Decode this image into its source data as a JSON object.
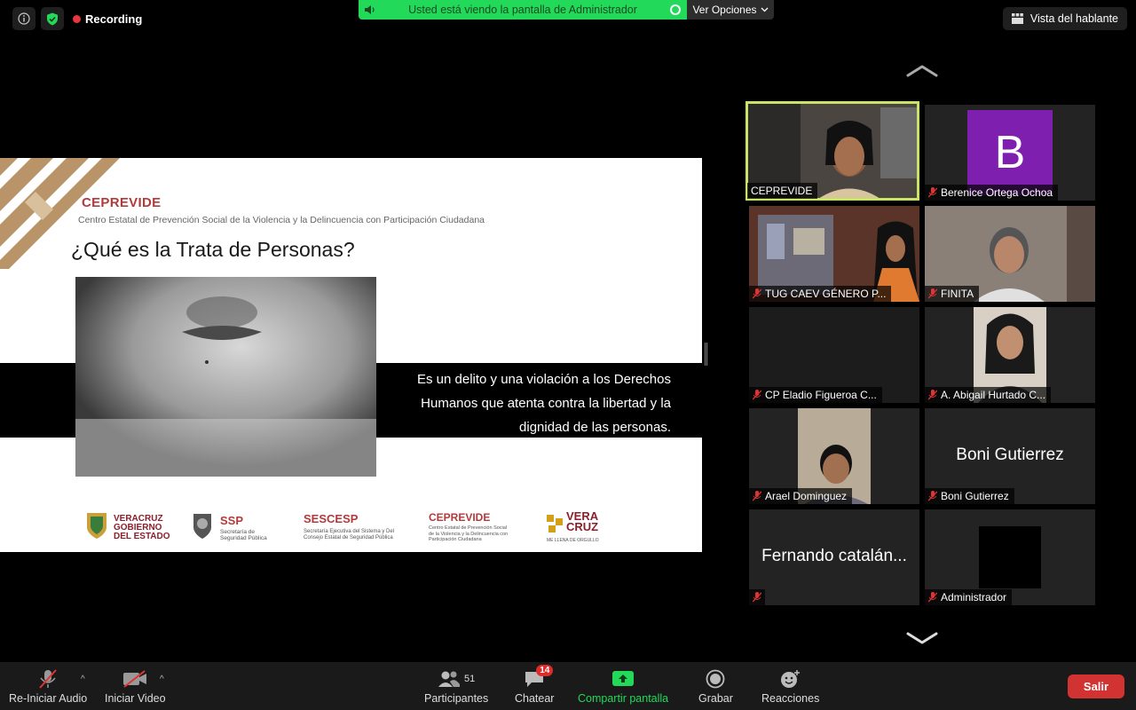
{
  "recording_label": "Recording",
  "share_banner_text": "Usted está viendo la pantalla de Administrador",
  "view_options_label": "Ver Opciones",
  "speaker_view_label": "Vista del hablante",
  "slide": {
    "org": "CEPREVIDE",
    "org_full": "Centro Estatal de Prevención Social de la Violencia y la Delincuencia con Participación Ciudadana",
    "question": "¿Qué es la Trata de Personas?",
    "answer": "Es un delito y una violación a los Derechos Humanos que atenta contra la libertad y la dignidad de las personas.",
    "logos": {
      "veracruz_line1": "VERACRUZ",
      "veracruz_line2": "GOBIERNO",
      "veracruz_line3": "DEL ESTADO",
      "ssp_title": "SSP",
      "ssp_sub1": "Secretaría de",
      "ssp_sub2": "Seguridad Pública",
      "sescesp_title": "SESCESP",
      "sescesp_sub1": "Secretaría Ejecutiva del Sistema y Del",
      "sescesp_sub2": "Consejo Estatal de Seguridad Pública",
      "ceprevide_title": "CEPREVIDE",
      "ceprevide_sub1": "Centro Estatal de Prevención Social",
      "ceprevide_sub2": "de la Violencia y la Delincuencia con",
      "ceprevide_sub3": "Participación Ciudadana",
      "vera_line1": "VERA",
      "vera_line2": "CRUZ",
      "vera_tagline": "ME LLENA DE ORGULLO"
    }
  },
  "participants": [
    {
      "name": "CEPREVIDE",
      "type": "video",
      "active": true,
      "muted": false
    },
    {
      "name": "Berenice Ortega Ochoa",
      "type": "avatar",
      "initial": "B",
      "muted": true
    },
    {
      "name": "TUG CAEV GÉNERO P...",
      "type": "video",
      "muted": true
    },
    {
      "name": "FINITA",
      "type": "video",
      "muted": true
    },
    {
      "name": "CP Eladio Figueroa C...",
      "type": "dark",
      "muted": true
    },
    {
      "name": "A. Abigail Hurtado C...",
      "type": "video",
      "muted": true
    },
    {
      "name": "Arael Dominguez",
      "type": "video",
      "muted": true
    },
    {
      "name": "Boni Gutierrez",
      "type": "text",
      "big": "Boni Gutierrez",
      "muted": true
    },
    {
      "name": "",
      "type": "text",
      "big": "Fernando catalán...",
      "muted": true
    },
    {
      "name": "Administrador",
      "type": "black",
      "muted": true
    }
  ],
  "toolbar": {
    "audio_label": "Re-Iniciar Audio",
    "video_label": "Iniciar Video",
    "participants_label": "Participantes",
    "participants_count": "51",
    "chat_label": "Chatear",
    "chat_badge": "14",
    "share_label": "Compartir pantalla",
    "record_label": "Grabar",
    "reactions_label": "Reacciones",
    "leave_label": "Salir"
  },
  "colors": {
    "share_green": "#23d959",
    "active_speaker": "#c8e26a",
    "leave_red": "#d13232",
    "brand_red": "#b33a3a",
    "avatar_purple": "#7f1fb0"
  }
}
